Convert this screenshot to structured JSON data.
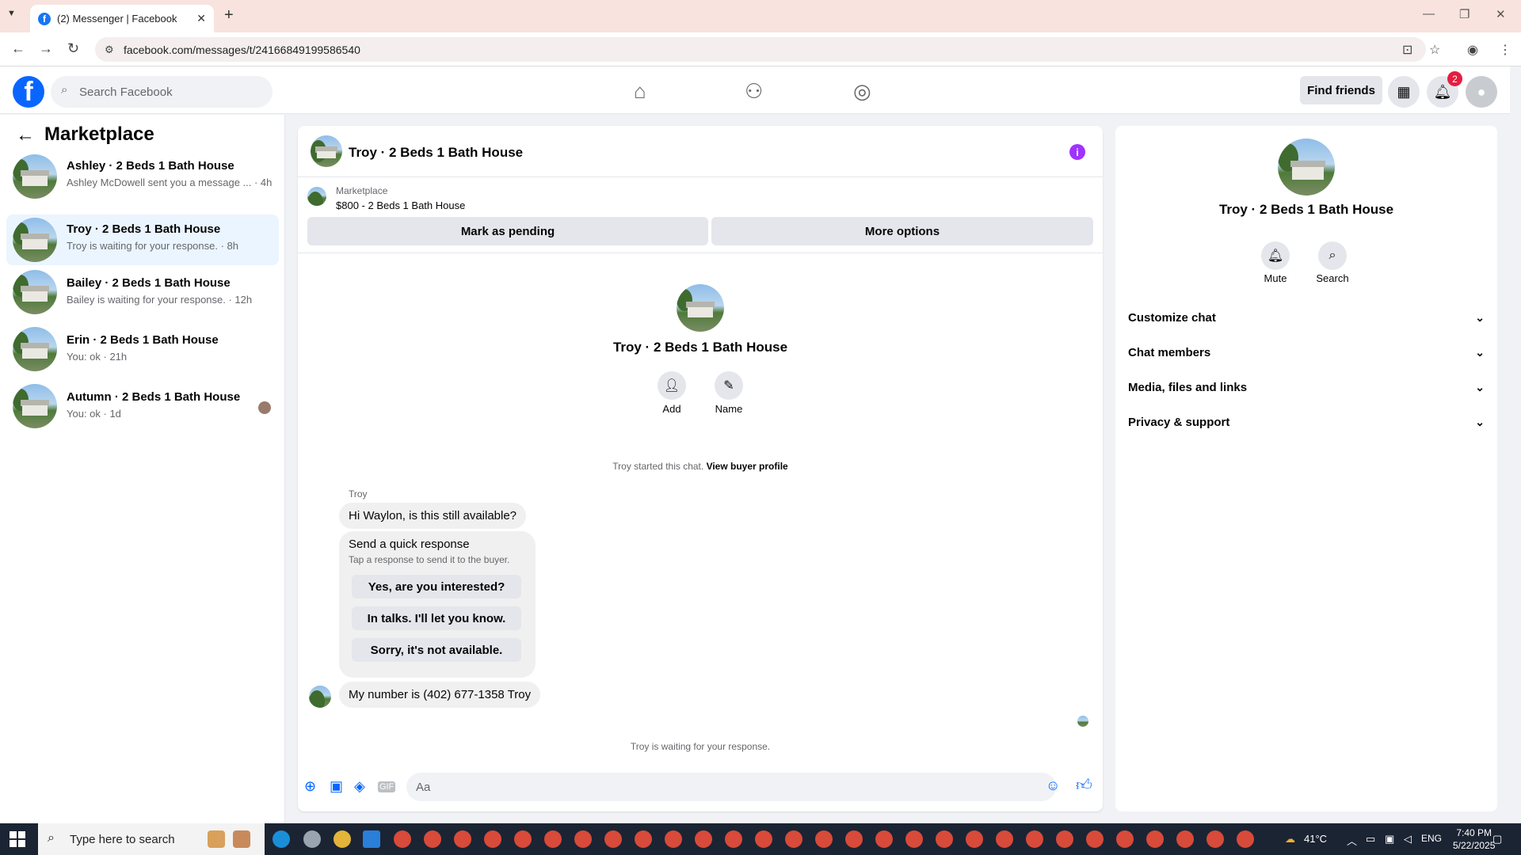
{
  "browser": {
    "tab_title": "(2) Messenger | Facebook",
    "url": "facebook.com/messages/t/24166849199586540"
  },
  "header": {
    "search_placeholder": "Search Facebook",
    "find_friends": "Find friends",
    "notification_count": "2"
  },
  "sidebar": {
    "title": "Marketplace",
    "conversations": [
      {
        "name": "Ashley · 2 Beds 1 Bath House",
        "preview": "Ashley McDowell sent you a message ... · 4h",
        "active": false
      },
      {
        "name": "Troy · 2 Beds 1 Bath House",
        "preview": "Troy is waiting for your response. · 8h",
        "active": true
      },
      {
        "name": "Bailey · 2 Beds 1 Bath House",
        "preview": "Bailey is waiting for your response. · 12h",
        "active": false
      },
      {
        "name": "Erin · 2 Beds 1 Bath House",
        "preview": "You: ok · 21h",
        "active": false
      },
      {
        "name": "Autumn · 2 Beds 1 Bath House",
        "preview": "You: ok · 1d",
        "active": false
      }
    ]
  },
  "chat": {
    "title": "Troy · 2 Beds 1 Bath House",
    "marketplace_label": "Marketplace",
    "listing": "$800 - 2 Beds 1 Bath House",
    "mark_pending": "Mark as pending",
    "more_options": "More options",
    "center_name": "Troy · 2 Beds 1 Bath House",
    "add_label": "Add",
    "name_label": "Name",
    "started_text": "Troy started this chat.",
    "view_buyer_profile": "View buyer profile",
    "sender": "Troy",
    "msg1": "Hi Waylon, is this still available?",
    "quick_title": "Send a quick response",
    "quick_sub": "Tap a response to send it to the buyer.",
    "quick_responses": [
      "Yes, are you interested?",
      "In talks. I'll let you know.",
      "Sorry, it's not available."
    ],
    "msg2": "My number is (402) 677-1358 Troy",
    "waiting": "Troy is waiting for your response.",
    "composer_placeholder": "Aa"
  },
  "details": {
    "name": "Troy · 2 Beds 1 Bath House",
    "mute_label": "Mute",
    "search_label": "Search",
    "sections": [
      "Customize chat",
      "Chat members",
      "Media, files and links",
      "Privacy & support"
    ]
  },
  "taskbar": {
    "search_placeholder": "Type here to search",
    "weather": "41°C",
    "lang": "ENG",
    "time": "7:40 PM",
    "date": "5/22/2025"
  },
  "colors": {
    "facebook_blue": "#0866ff",
    "active_conversation": "#ebf5ff",
    "info_purple": "#a033ff",
    "badge_red": "#e41e3f"
  }
}
